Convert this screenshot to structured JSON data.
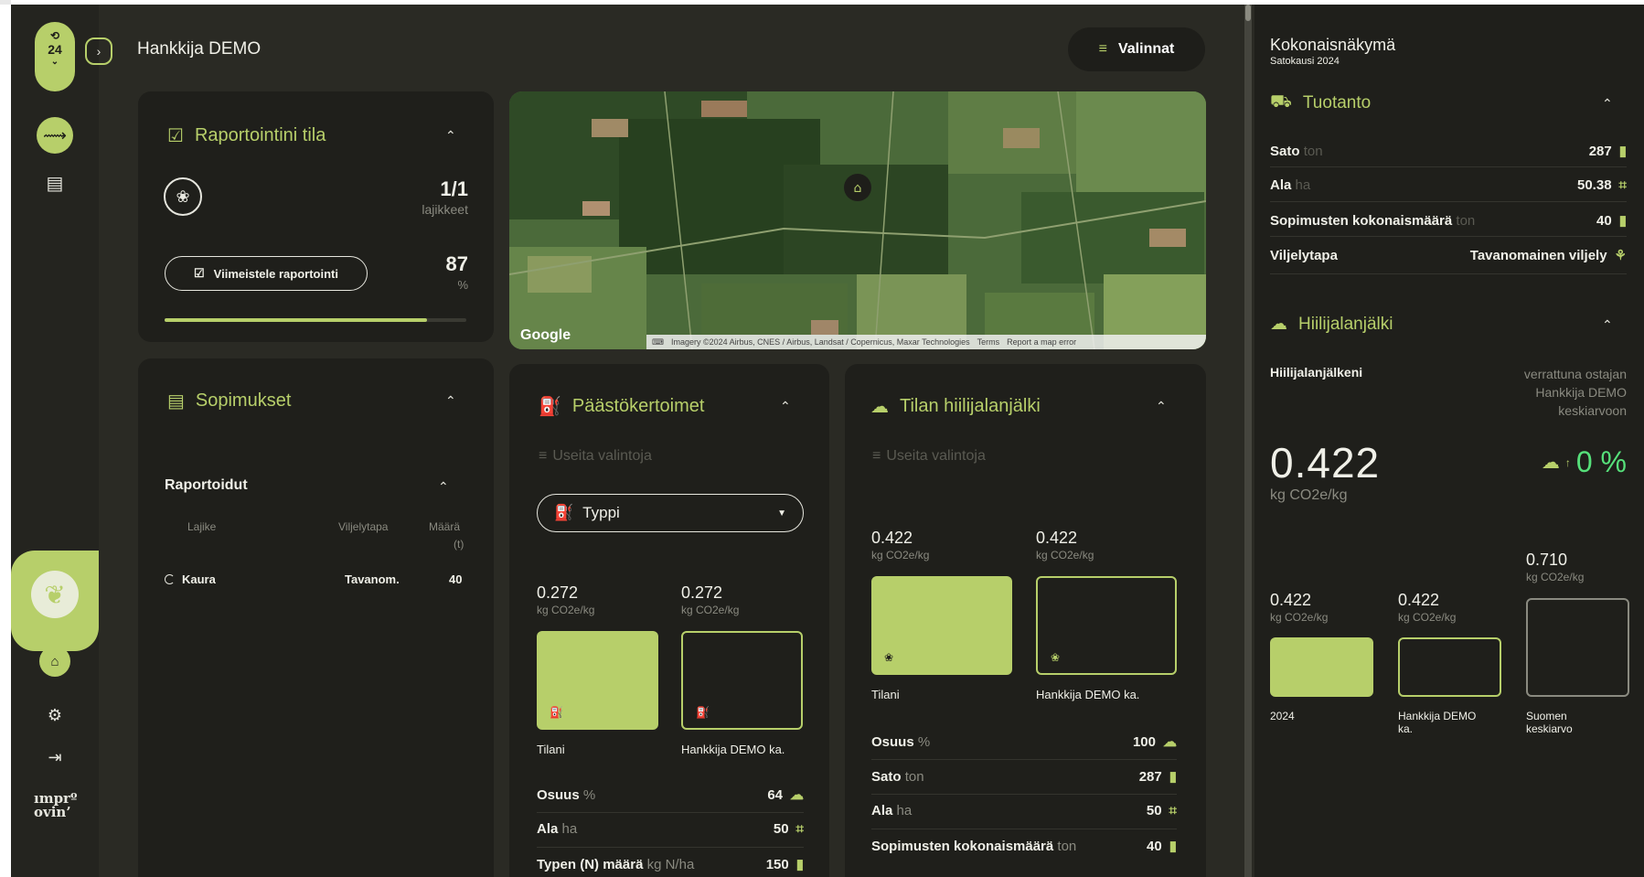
{
  "sidebar": {
    "season_label": "24",
    "items": [
      "insights-icon",
      "report-icon",
      "leaf-icon",
      "farm-icon",
      "settings-icon",
      "logout-icon"
    ],
    "logo_line1": "ımprº",
    "logo_line2": "ovin’"
  },
  "header": {
    "title": "Hankkija DEMO",
    "options_label": "Valinnat"
  },
  "reporting": {
    "title": "Raportointini tila",
    "count": "1/1",
    "count_label": "lajikkeet",
    "finish_button": "Viimeistele raportointi",
    "percent": "87",
    "percent_unit": "%",
    "progress": 0.87
  },
  "map": {
    "google_label": "Google",
    "attribution": "Imagery ©2024 Airbus, CNES / Airbus, Landsat / Copernicus, Maxar Technologies",
    "terms": "Terms",
    "report": "Report a map error"
  },
  "contracts": {
    "title": "Sopimukset",
    "section": "Raportoidut",
    "columns": [
      "Lajike",
      "Viljelytapa",
      "Määrä",
      "(t)"
    ],
    "rows": [
      {
        "crop": "Kaura",
        "method": "Tavanom.",
        "amount": "40"
      }
    ]
  },
  "emissions": {
    "title": "Päästökertoimet",
    "filter": "Useita valintoja",
    "select_value": "Typpi",
    "bar1_value": "0.272",
    "bar1_unit": "kg CO2e/kg",
    "bar1_label": "Tilani",
    "bar2_value": "0.272",
    "bar2_unit": "kg CO2e/kg",
    "bar2_label": "Hankkija DEMO ka.",
    "rows": [
      {
        "label": "Osuus",
        "unit": "%",
        "value": "64"
      },
      {
        "label": "Ala",
        "unit": "ha",
        "value": "50"
      },
      {
        "label": "Typen (N) määrä",
        "unit": "kg N/ha",
        "value": "150"
      }
    ]
  },
  "farm_footprint": {
    "title": "Tilan hiilijalanjälki",
    "filter": "Useita valintoja",
    "bar1_value": "0.422",
    "bar1_unit": "kg CO2e/kg",
    "bar1_label": "Tilani",
    "bar2_value": "0.422",
    "bar2_unit": "kg CO2e/kg",
    "bar2_label": "Hankkija DEMO ka.",
    "rows": [
      {
        "label": "Osuus",
        "unit": "%",
        "value": "100"
      },
      {
        "label": "Sato",
        "unit": "ton",
        "value": "287"
      },
      {
        "label": "Ala",
        "unit": "ha",
        "value": "50"
      },
      {
        "label": "Sopimusten kokonaismäärä",
        "unit": "ton",
        "value": "40"
      }
    ]
  },
  "overview": {
    "title": "Kokonaisnäkymä",
    "subtitle": "Satokausi 2024",
    "production_title": "Tuotanto",
    "rows": [
      {
        "label": "Sato",
        "unit": "ton",
        "value": "287"
      },
      {
        "label": "Ala",
        "unit": "ha",
        "value": "50.38"
      },
      {
        "label": "Sopimusten kokonaismäärä",
        "unit": "ton",
        "value": "40"
      },
      {
        "label": "Viljelytapa",
        "unit": "",
        "value": "Tavanomainen viljely"
      }
    ],
    "footprint_title": "Hiilijalanjälki",
    "footprint_label": "Hiilijalanjälkeni",
    "compare_text_1": "verrattuna ostajan",
    "compare_text_2": "Hankkija DEMO",
    "compare_text_3": "keskiarvoon",
    "big_value": "0.422",
    "big_unit": "kg CO2e/kg",
    "delta": "0 %",
    "bars": [
      {
        "value": "0.422",
        "unit": "kg CO2e/kg",
        "label1": "2024",
        "label2": ""
      },
      {
        "value": "0.422",
        "unit": "kg CO2e/kg",
        "label1": "Hankkija DEMO",
        "label2": "ka."
      },
      {
        "value": "0.710",
        "unit": "kg CO2e/kg",
        "label1": "Suomen",
        "label2": "keskiarvo"
      }
    ]
  },
  "colors": {
    "accent": "#b7cf6a",
    "background": "#2a2a24",
    "card": "#1f1f1b",
    "delta": "#56e07a"
  }
}
